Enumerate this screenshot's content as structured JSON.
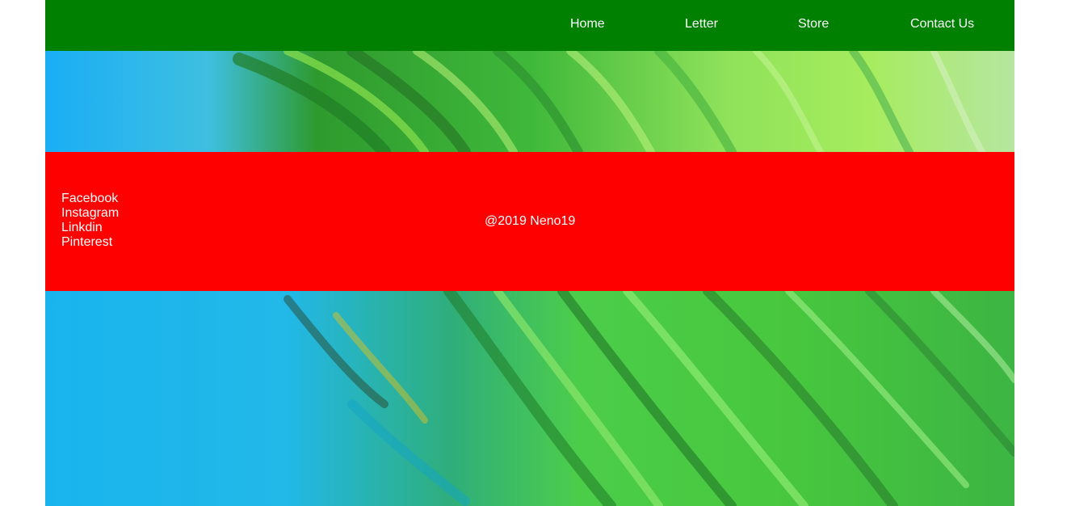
{
  "nav": {
    "items": [
      {
        "label": "Home"
      },
      {
        "label": "Letter"
      },
      {
        "label": "Store"
      },
      {
        "label": "Contact Us"
      }
    ]
  },
  "footer": {
    "social_links": [
      {
        "label": "Facebook"
      },
      {
        "label": "Instagram"
      },
      {
        "label": "Linkdin"
      },
      {
        "label": "Pinterest"
      }
    ],
    "copyright": "@2019 Neno19"
  },
  "colors": {
    "navbar_bg": "#008000",
    "footer_bg": "#ff0000",
    "text": "#ffffff",
    "page_bg": "#ffffff"
  }
}
